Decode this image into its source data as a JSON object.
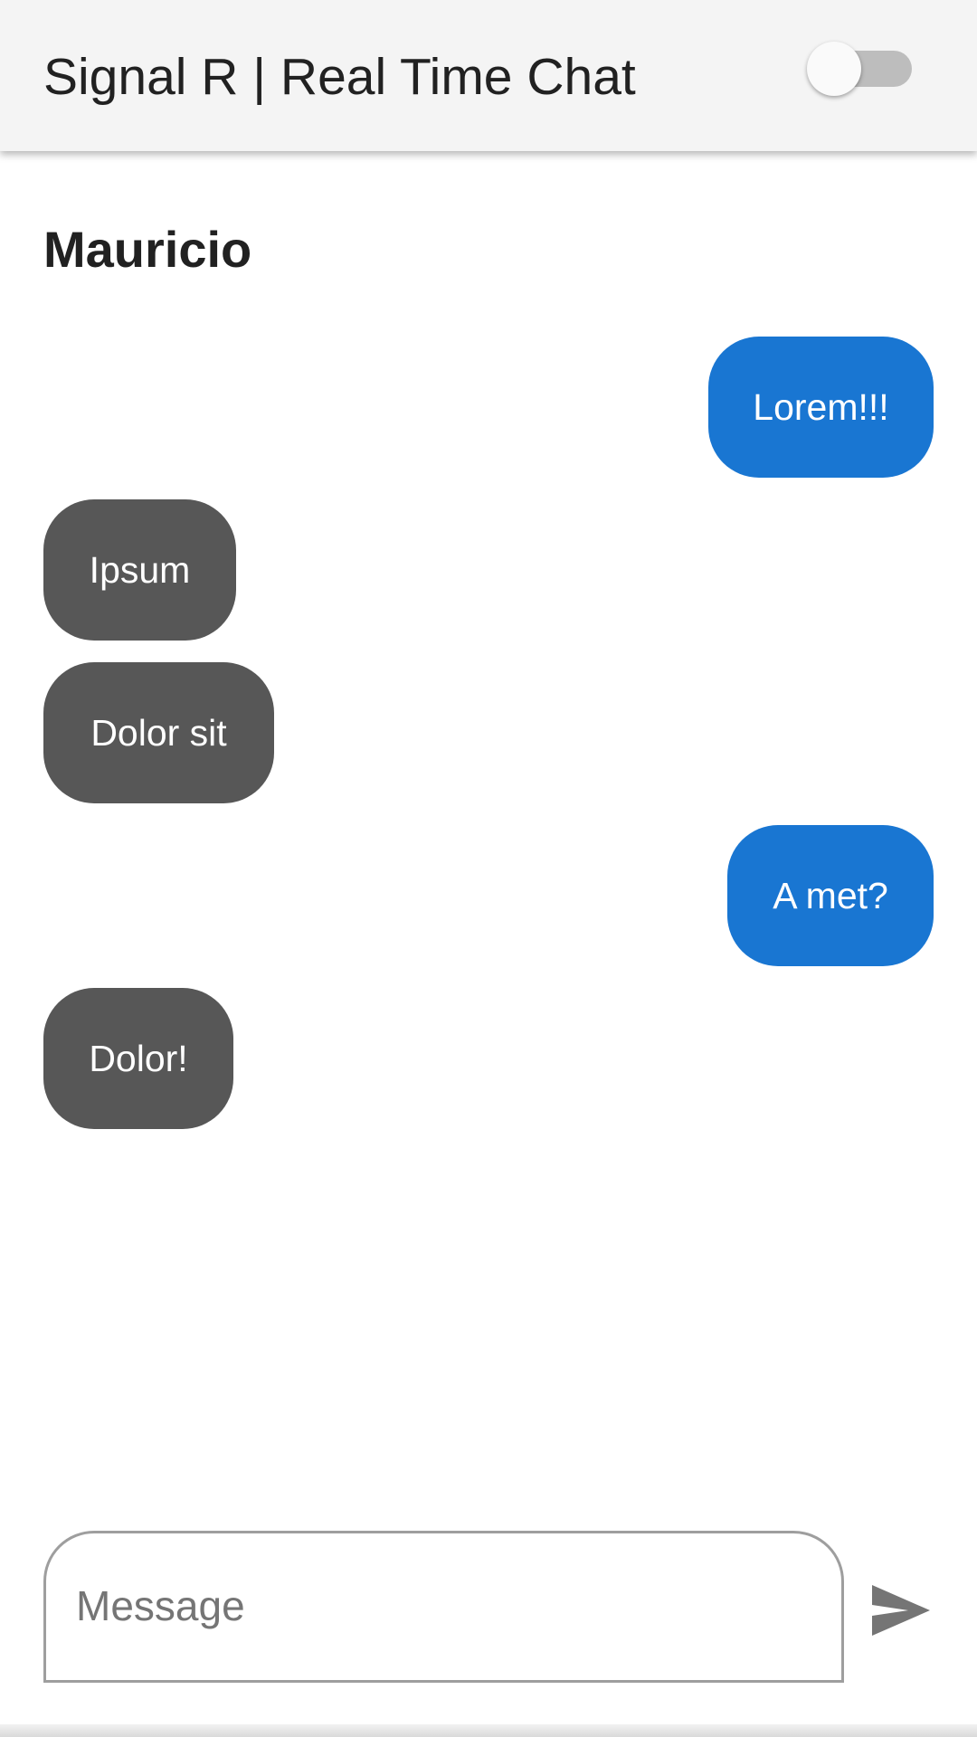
{
  "app_bar": {
    "title": "Signal R | Real Time Chat",
    "toggle_on": false
  },
  "chat": {
    "user_name": "Mauricio",
    "messages": [
      {
        "text": "Lorem!!!",
        "direction": "outgoing"
      },
      {
        "text": "Ipsum",
        "direction": "incoming"
      },
      {
        "text": "Dolor sit",
        "direction": "incoming"
      },
      {
        "text": "A met?",
        "direction": "outgoing"
      },
      {
        "text": "Dolor!",
        "direction": "incoming"
      }
    ]
  },
  "composer": {
    "placeholder": "Message",
    "value": "",
    "send_icon": "send-icon"
  },
  "colors": {
    "app_bar_bg": "#f4f4f4",
    "outgoing_bubble": "#1976d2",
    "incoming_bubble": "#575757",
    "send_icon": "#757575"
  }
}
